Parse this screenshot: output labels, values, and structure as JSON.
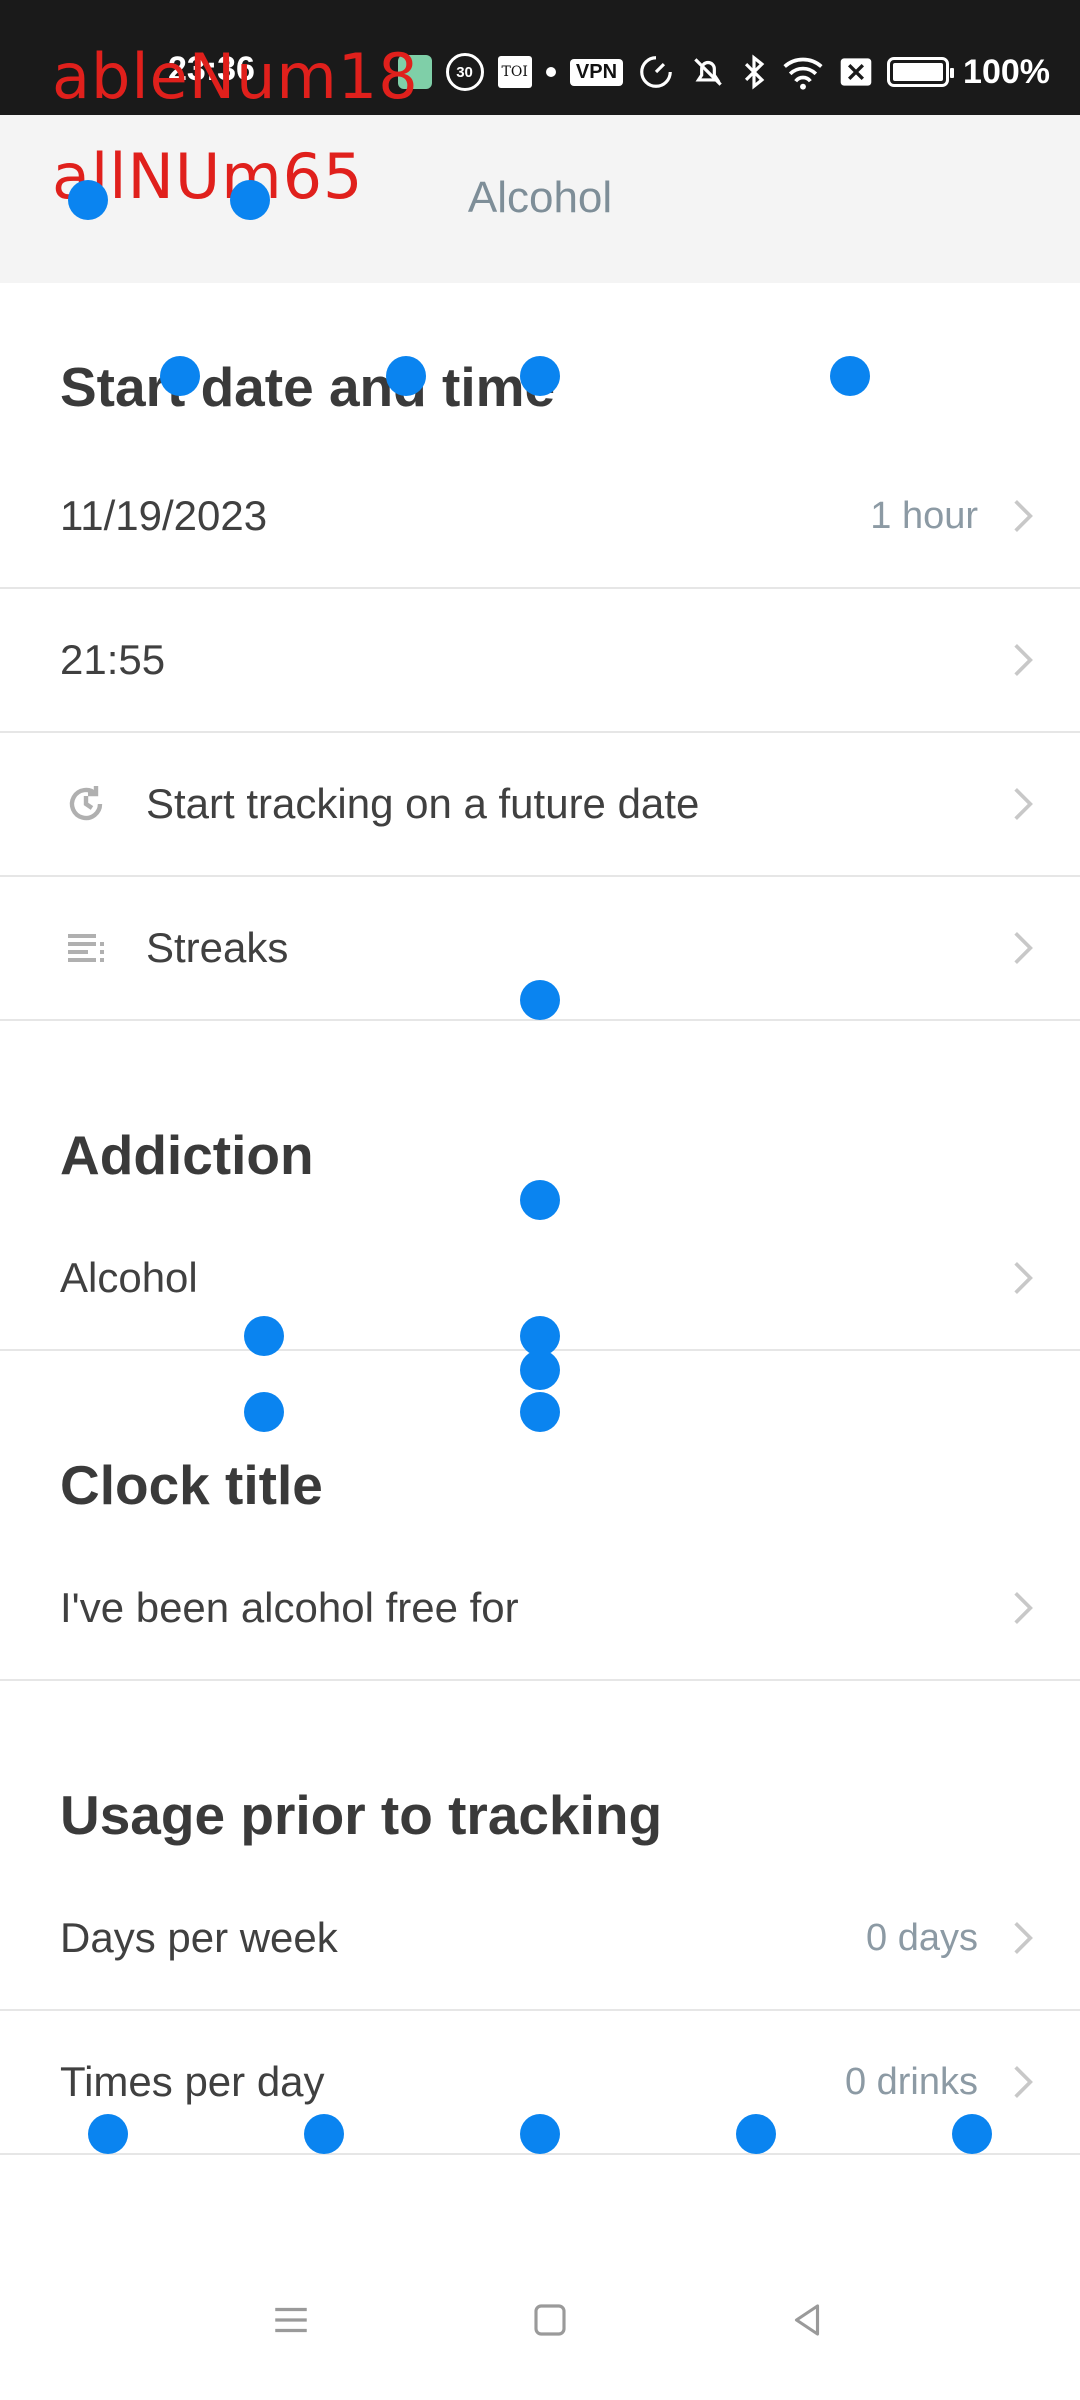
{
  "status_bar": {
    "time": "23:36",
    "circle_badge": "30",
    "toi_badge": "TOI",
    "vpn_label": "VPN",
    "battery_level": 1.0,
    "battery_text": "100%"
  },
  "overlay": {
    "line1": "ableNum18",
    "line2": "allNUm65"
  },
  "toolbar": {
    "title": "Alcohol"
  },
  "sections": {
    "start": {
      "title": "Start date and time",
      "date_label": "11/19/2023",
      "date_value": "1 hour",
      "time_label": "21:55",
      "future_label": "Start tracking on a future date",
      "streaks_label": "Streaks"
    },
    "addiction": {
      "title": "Addiction",
      "value": "Alcohol"
    },
    "clock": {
      "title": "Clock title",
      "value": "I've been alcohol free for"
    },
    "usage": {
      "title": "Usage prior to tracking",
      "days_label": "Days per week",
      "days_value": "0 days",
      "times_label": "Times per day",
      "times_value": "0 drinks"
    }
  },
  "colors": {
    "touch_dot": "#0a84f0",
    "overlay_text": "#e0201c",
    "toolbar_title": "#7e8e98"
  }
}
